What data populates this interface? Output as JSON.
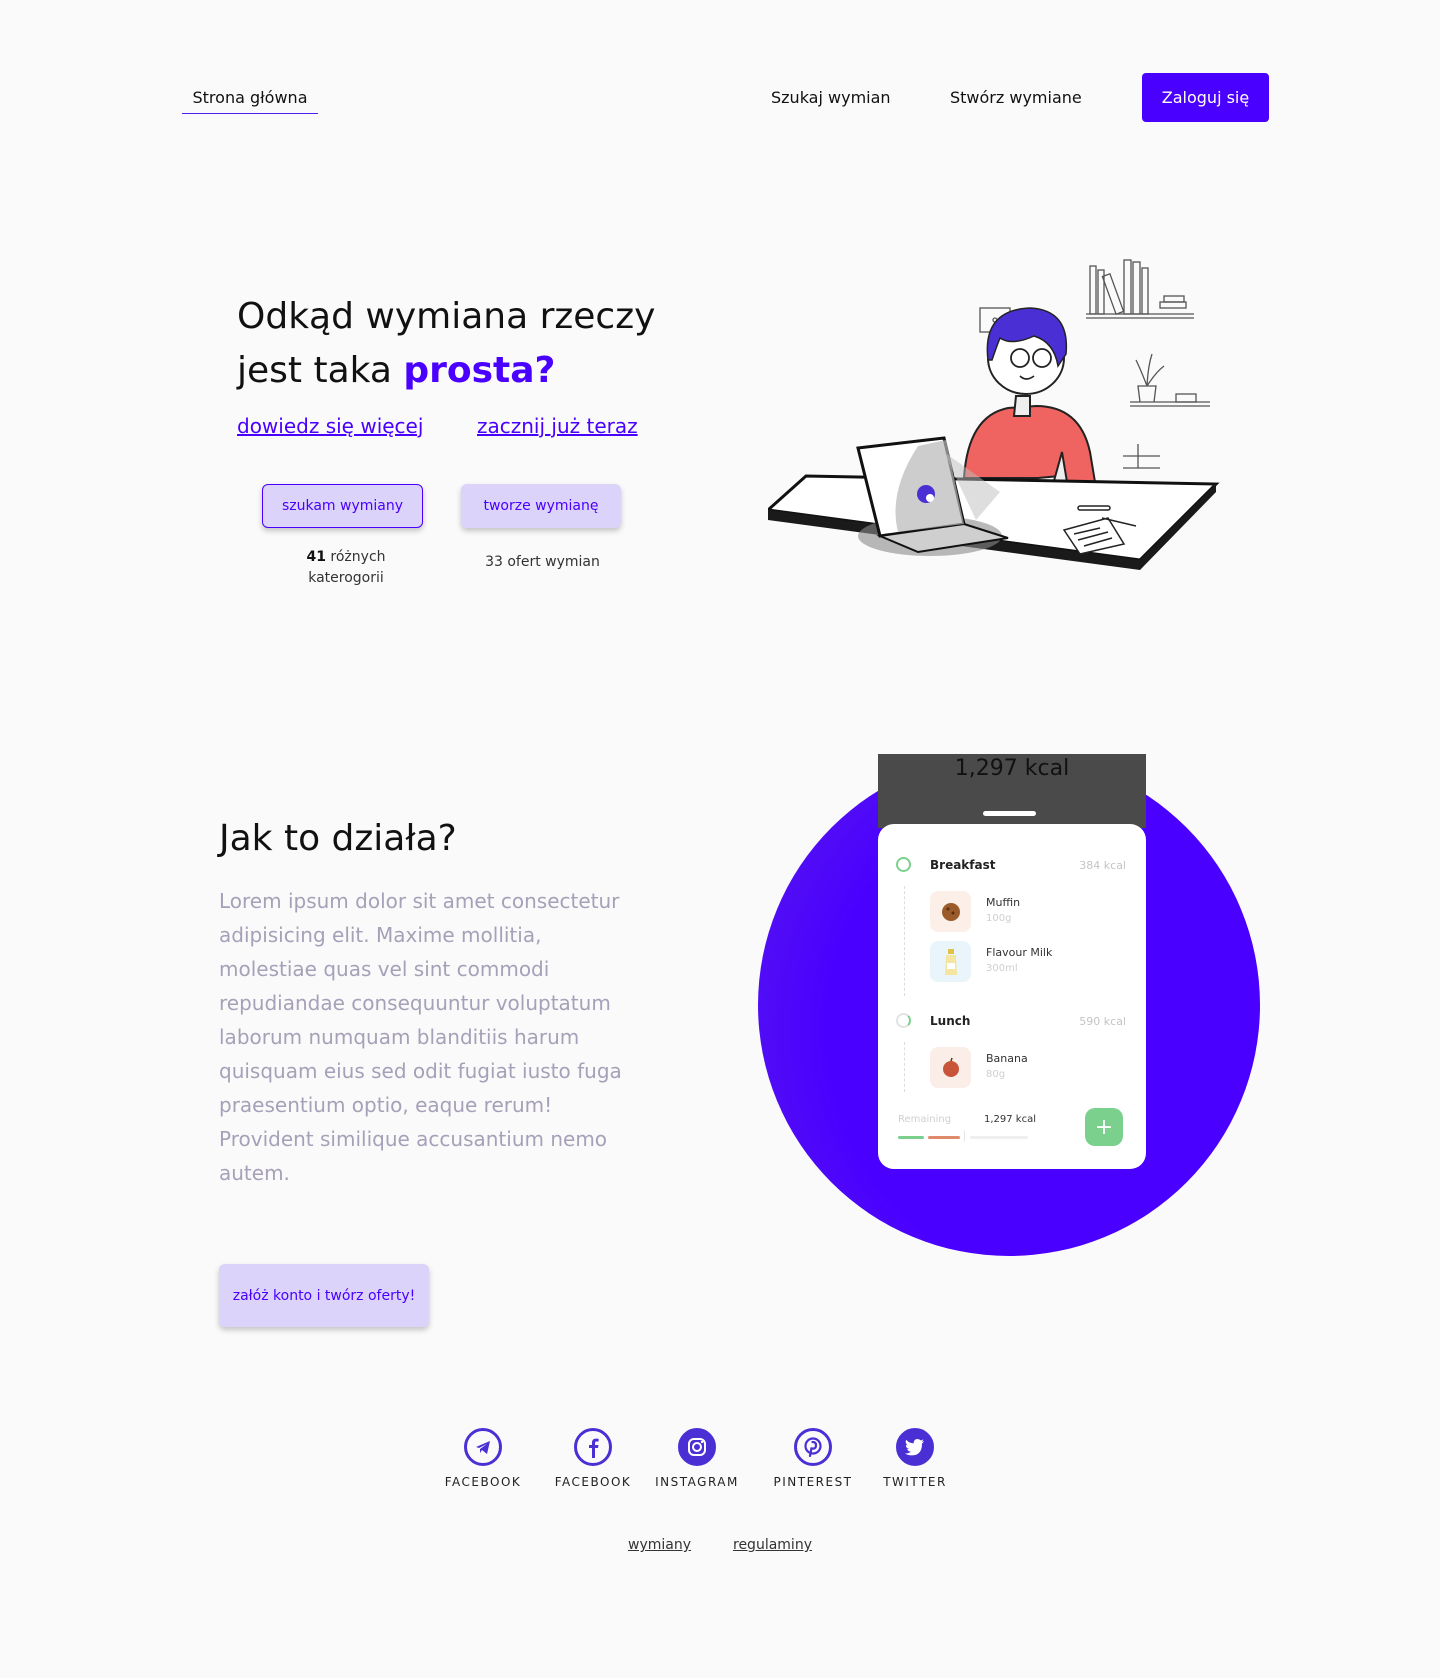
{
  "nav": {
    "home": "Strona główna",
    "search": "Szukaj wymian",
    "create": "Stwórz wymiane",
    "login": "Zaloguj się"
  },
  "hero": {
    "title_line1": "Odkąd wymiana rzeczy",
    "title_line2_prefix": "jest taka ",
    "title_line2_accent": "prosta?",
    "link_learn": "dowiedz się więcej",
    "link_start": "zacznij już teraz",
    "btn_search": "szukam wymiany",
    "btn_create": "tworze wymianę",
    "stat_categories_num": "41",
    "stat_categories_text": " różnych",
    "stat_categories_text2": "katerogorii",
    "stat_offers": "33 ofert wymian"
  },
  "how": {
    "title": "Jak to działa?",
    "text": "Lorem ipsum dolor sit amet consectetur adipisicing elit. Maxime mollitia, molestiae quas vel sint commodi repudiandae consequuntur voluptatum laborum numquam blanditiis harum quisquam eius sed odit fugiat iusto fuga praesentium optio, eaque rerum! Provident similique accusantium nemo autem.",
    "cta": "załóż konto i twórz oferty!"
  },
  "phone": {
    "header_kcal": "1,297 kcal",
    "breakfast": {
      "title": "Breakfast",
      "kcal": "384 kcal"
    },
    "muffin": {
      "name": "Muffin",
      "qty": "100g"
    },
    "milk": {
      "name": "Flavour Milk",
      "qty": "300ml"
    },
    "lunch": {
      "title": "Lunch",
      "kcal": "590 kcal"
    },
    "banana": {
      "name": "Banana",
      "qty": "80g"
    },
    "remaining_label": "Remaining",
    "remaining_value": "1,297 kcal",
    "add": "+"
  },
  "social": [
    {
      "label": "FACEBOOK",
      "icon": "telegram-icon"
    },
    {
      "label": "FACEBOOK",
      "icon": "facebook-icon"
    },
    {
      "label": "INSTAGRAM",
      "icon": "instagram-icon"
    },
    {
      "label": "PINTEREST",
      "icon": "pinterest-icon"
    },
    {
      "label": "TWITTER",
      "icon": "twitter-icon"
    }
  ],
  "footer": {
    "link1": "wymiany",
    "link2": "regulaminy"
  },
  "colors": {
    "accent": "#4a00ff",
    "pill_bg": "#dcd3fb",
    "green": "#7bd08d",
    "shirt": "#ef6461"
  }
}
